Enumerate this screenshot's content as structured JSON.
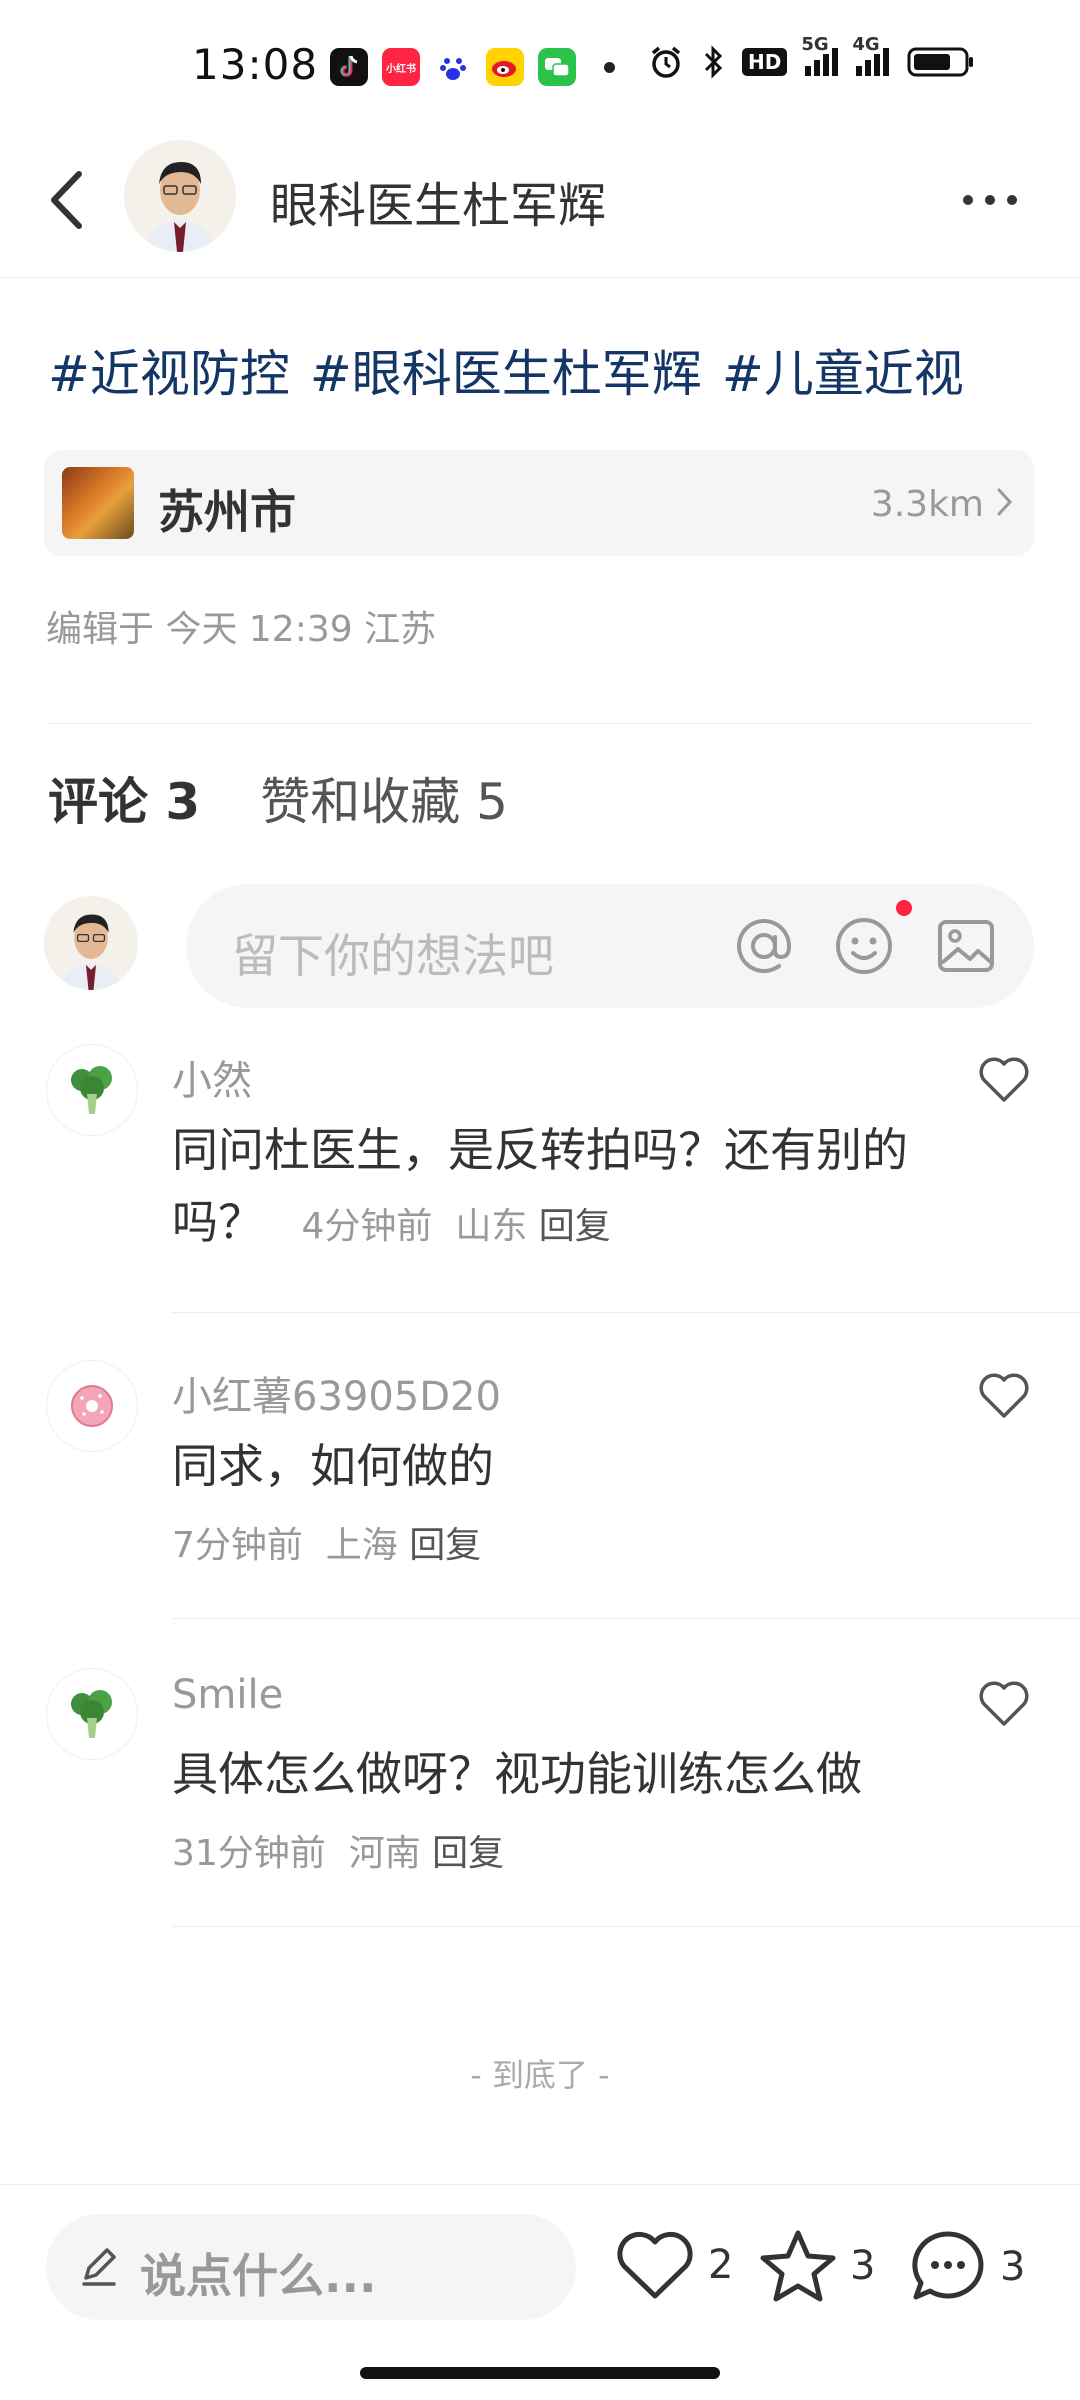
{
  "status_bar": {
    "time": "13:08",
    "app_icons": [
      "tiktok-icon",
      "xiaohongshu-icon",
      "baidu-icon",
      "weibo-icon",
      "wechat-icon"
    ],
    "xiaohongshu_label": "小红书",
    "system_icons": [
      "alarm-icon",
      "bluetooth-icon",
      "hd-icon",
      "5g-signal-icon",
      "4g-signal-icon",
      "battery-icon"
    ],
    "hd_label": "HD",
    "net1": "5G",
    "net2": "4G"
  },
  "header": {
    "author_name": "眼科医生杜军辉"
  },
  "post": {
    "tags": [
      "#近视防控",
      "#眼科医生杜军辉",
      "#儿童近视"
    ],
    "location": {
      "name": "苏州市",
      "distance": "3.3km"
    },
    "edit_info": "编辑于 今天 12:39 江苏"
  },
  "tabs": {
    "comments_label": "评论 3",
    "likes_label": "赞和收藏 5"
  },
  "comment_input": {
    "placeholder": "留下你的想法吧"
  },
  "comments": [
    {
      "user": "小然",
      "text": "同问杜医生，是反转拍吗？还有别的吗？",
      "time": "4分钟前",
      "region": "山东",
      "reply": "回复"
    },
    {
      "user": "小红薯63905D20",
      "text": "同求，如何做的",
      "time": "7分钟前",
      "region": "上海",
      "reply": "回复"
    },
    {
      "user": "Smile",
      "text": "具体怎么做呀？视功能训练怎么做",
      "time": "31分钟前",
      "region": "河南",
      "reply": "回复"
    }
  ],
  "end_text": "- 到底了 -",
  "bottom_bar": {
    "say_placeholder": "说点什么...",
    "likes": "2",
    "collects": "3",
    "comments": "3"
  },
  "colors": {
    "tag": "#133667",
    "accent_red": "#ff2442",
    "muted": "#999999"
  }
}
